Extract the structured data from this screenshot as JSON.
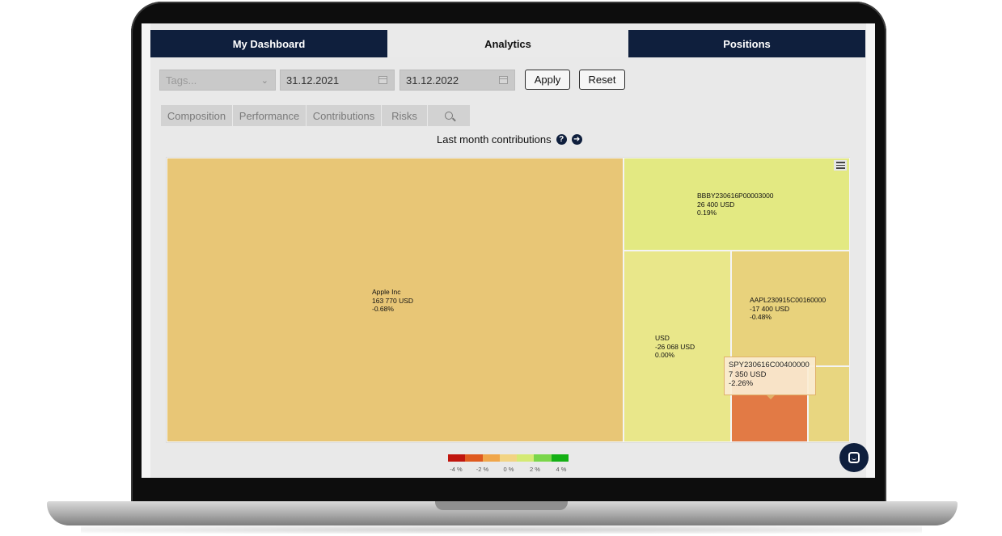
{
  "tabs": [
    {
      "label": "My Dashboard"
    },
    {
      "label": "Analytics"
    },
    {
      "label": "Positions"
    }
  ],
  "filters": {
    "tags_placeholder": "Tags...",
    "date_from": "31.12.2021",
    "date_to": "31.12.2022",
    "apply_label": "Apply",
    "reset_label": "Reset"
  },
  "subtabs": [
    {
      "label": "Composition"
    },
    {
      "label": "Performance"
    },
    {
      "label": "Contributions"
    },
    {
      "label": "Risks"
    }
  ],
  "chart_title": "Last month contributions",
  "icons": {
    "help": "question-circle-icon",
    "next": "arrow-right-circle-icon",
    "search": "search-icon",
    "menu": "hamburger-menu-icon",
    "chat": "chat-icon",
    "dropdown": "chevron-down-icon",
    "calendar": "calendar-icon"
  },
  "chart_data": {
    "type": "treemap",
    "title": "Last month contributions",
    "nodes": [
      {
        "name": "Apple Inc",
        "value_label": "163 770 USD",
        "change_label": "-0.68%",
        "value": 163770,
        "change": -0.68,
        "color": "#e8c676"
      },
      {
        "name": "BBBY230616P00003000",
        "value_label": "26 400 USD",
        "change_label": "0.19%",
        "value": 26400,
        "change": 0.19,
        "color": "#e3e982"
      },
      {
        "name": "USD",
        "value_label": "-26 068 USD",
        "change_label": "0.00%",
        "value": -26068,
        "change": 0.0,
        "color": "#e9e78a"
      },
      {
        "name": "AAPL230915C00160000",
        "value_label": "-17 400 USD",
        "change_label": "-0.48%",
        "value": -17400,
        "change": -0.48,
        "color": "#e8d27c"
      },
      {
        "name": "SPY230616C00400000",
        "value_label": "7 350 USD",
        "change_label": "-2.26%",
        "value": 7350,
        "change": -2.26,
        "color": "#e27a45"
      },
      {
        "name": "",
        "value_label": "",
        "change_label": "",
        "value": null,
        "change": null,
        "color": "#e8d680"
      }
    ],
    "tooltip": {
      "name": "SPY230616C00400000",
      "value_label": "7 350 USD",
      "change_label": "-2.26%"
    },
    "legend": {
      "colors": [
        "#c0160e",
        "#df5a1f",
        "#f0a64a",
        "#f2d483",
        "#d4ea74",
        "#7ad64a",
        "#14b014"
      ],
      "ticks": [
        "-4 %",
        "-2 %",
        "0 %",
        "2 %",
        "4 %"
      ]
    }
  }
}
